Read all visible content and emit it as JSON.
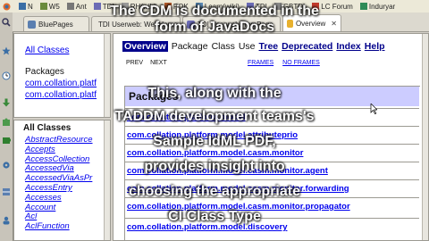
{
  "bookmarks": [
    {
      "label": "N",
      "color": "#3a6ea5"
    },
    {
      "label": "W5",
      "color": "#6a8b3c"
    },
    {
      "label": "Ant",
      "color": "#777777"
    },
    {
      "label": "TDI",
      "color": "#6b6bb5"
    },
    {
      "label": "RH(wiki)",
      "color": "#999999"
    },
    {
      "label": "POK",
      "color": "#b55a2b"
    },
    {
      "label": "Learn(wiki)",
      "color": "#5a8ab5"
    },
    {
      "label": "TDI",
      "color": "#6b6bb5"
    },
    {
      "label": "GBTDI",
      "color": "#8a8a8a"
    },
    {
      "label": "LC Forum",
      "color": "#c0392b"
    },
    {
      "label": "Induryar",
      "color": "#2e8b57"
    }
  ],
  "tabs": [
    {
      "label": "BluePages",
      "active": false
    },
    {
      "label": "TDI Userweb: WebHome",
      "active": false
    },
    {
      "label": "TDI Userweb: TomPage",
      "active": false
    },
    {
      "label": "Overview",
      "active": true
    }
  ],
  "left_top": {
    "all_classes": "All Classes",
    "packages_header": "Packages",
    "packages": [
      "com.collation.platf",
      "com.collation.platf"
    ]
  },
  "left_bottom": {
    "header": "All Classes",
    "classes": [
      "AbstractResource",
      "Accepts",
      "AccessCollection",
      "AccessedVia",
      "AccessedViaAsPr",
      "AccessEntry",
      "Accesses",
      "Account",
      "Acl",
      "AclFunction"
    ]
  },
  "main": {
    "nav": {
      "overview": "Overview",
      "package": "Package",
      "class": "Class",
      "use": "Use",
      "tree": "Tree",
      "deprecated": "Deprecated",
      "index": "Index",
      "help": "Help"
    },
    "prev": "PREV",
    "next": "NEXT",
    "frames": "FRAMES",
    "no_frames": "NO FRAMES",
    "packages_title": "Packages",
    "packages": [
      "com.collation.platform.model",
      "com.collation.platform.model.attributeprio",
      "com.collation.platform.model.casm.monitor",
      "com.collation.platform.model.casm.monitor.agent",
      "com.collation.platform.model.casm.monitor.forwarding",
      "com.collation.platform.model.casm.monitor.propagator",
      "com.collation.platform.model.discovery"
    ]
  },
  "overlay_lines": [
    "The CDM is documented in the",
    "form of JavaDocs",
    "This, along with the",
    "TADDM development teams's",
    "Sample IdML PDF,",
    "provides insight into",
    "choosing the appropriate",
    "CI Class Type"
  ],
  "colors": {
    "nav_selected": "#00008b",
    "packages_header_bg": "#ccccff",
    "link": "#0000ee",
    "link_dark": "#00008b"
  }
}
